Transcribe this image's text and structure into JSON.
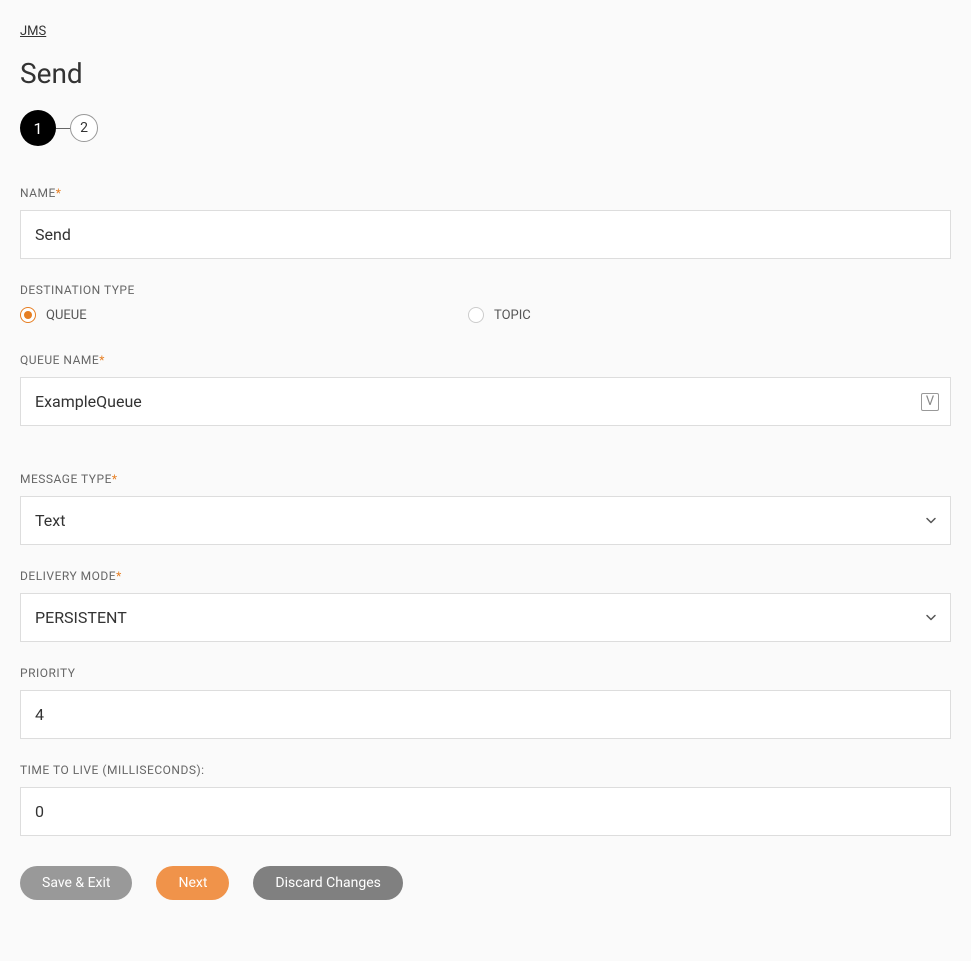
{
  "breadcrumb": "JMS",
  "page_title": "Send",
  "stepper": {
    "step1": "1",
    "step2": "2"
  },
  "fields": {
    "name": {
      "label": "NAME",
      "required": true,
      "value": "Send"
    },
    "destination_type": {
      "label": "DESTINATION TYPE",
      "options": {
        "queue": "QUEUE",
        "topic": "TOPIC"
      },
      "selected": "queue"
    },
    "queue_name": {
      "label": "QUEUE NAME",
      "required": true,
      "value": "ExampleQueue"
    },
    "message_type": {
      "label": "MESSAGE TYPE",
      "required": true,
      "value": "Text"
    },
    "delivery_mode": {
      "label": "DELIVERY MODE",
      "required": true,
      "value": "PERSISTENT"
    },
    "priority": {
      "label": "PRIORITY",
      "required": false,
      "value": "4"
    },
    "ttl": {
      "label": "TIME TO LIVE (MILLISECONDS):",
      "required": false,
      "value": "0"
    }
  },
  "buttons": {
    "save_exit": "Save & Exit",
    "next": "Next",
    "discard": "Discard Changes"
  },
  "required_star": "*"
}
